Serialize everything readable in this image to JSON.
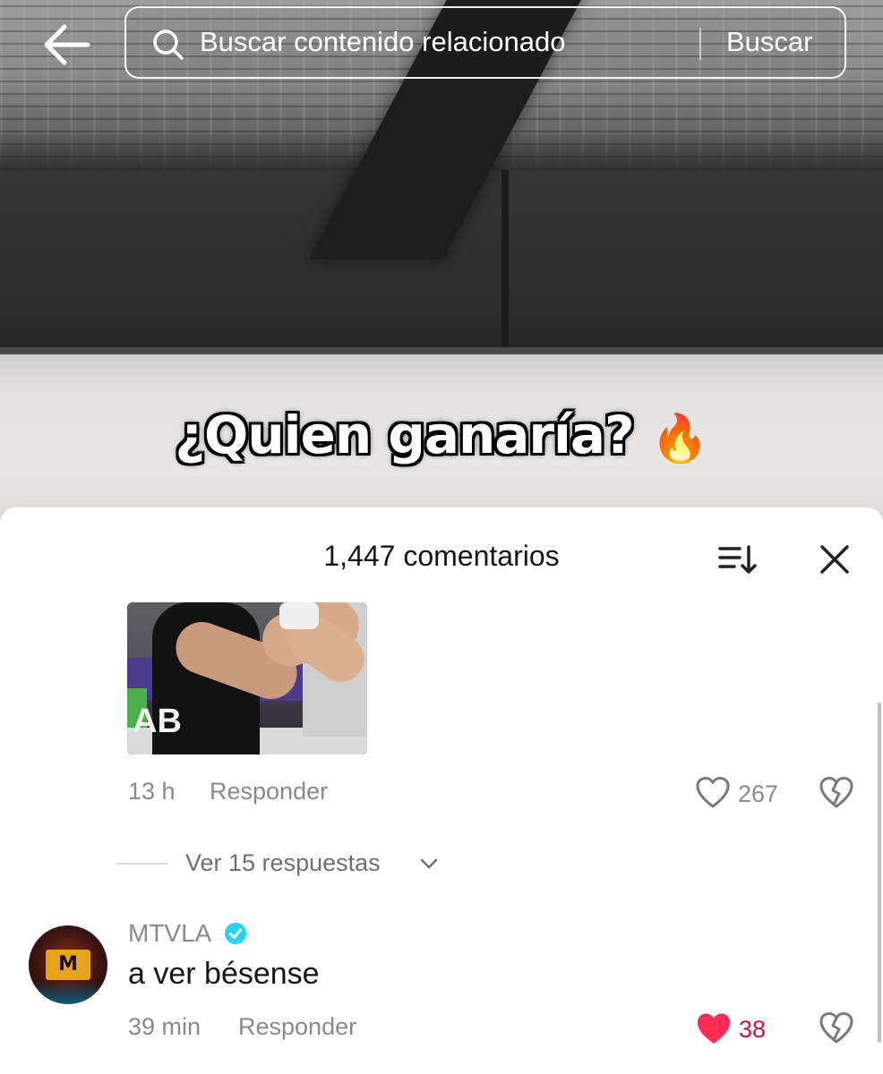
{
  "top_bar": {
    "search_placeholder": "Buscar contenido relacionado",
    "search_button": "Buscar"
  },
  "video": {
    "caption": "¿Quien ganaría?",
    "caption_emoji": "🔥"
  },
  "comments_sheet": {
    "title": "1,447 comentarios",
    "comments": [
      {
        "image_text": "AB",
        "time": "13 h",
        "reply_label": "Responder",
        "likes": "267",
        "liked": false,
        "view_replies": "Ver 15 respuestas"
      },
      {
        "username": "MTVLA",
        "verified": true,
        "avatar_text": "M",
        "text": "a ver bésense",
        "time": "39 min",
        "reply_label": "Responder",
        "likes": "38",
        "liked": true
      }
    ]
  },
  "colors": {
    "like_active": "#fe2c55",
    "verified": "#20d5ec",
    "muted_text": "#8a8a8a"
  },
  "icons": [
    "back-arrow-icon",
    "search-icon",
    "sort-icon",
    "close-icon",
    "heart-icon",
    "broken-heart-icon",
    "chevron-down-icon",
    "verified-badge-icon"
  ]
}
